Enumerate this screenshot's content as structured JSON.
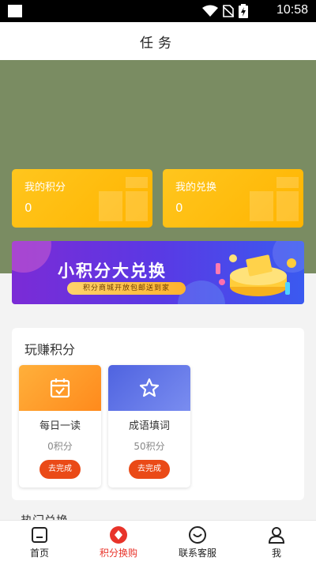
{
  "status": {
    "time": "10:58"
  },
  "header": {
    "title": "任务"
  },
  "cards": {
    "points": {
      "label": "我的积分",
      "value": "0"
    },
    "exchange": {
      "label": "我的兑换",
      "value": "0"
    }
  },
  "banner": {
    "title": "小积分大兑换",
    "subtitle": "积分商城开放包邮送到家"
  },
  "earn": {
    "title": "玩赚积分",
    "tasks": [
      {
        "name": "每日一读",
        "points": "0积分",
        "button": "去完成",
        "icon": "calendar-check-icon",
        "color": "#ff9a2b"
      },
      {
        "name": "成语填词",
        "points": "50积分",
        "button": "去完成",
        "icon": "star-icon",
        "color": "#5c6fe6"
      }
    ]
  },
  "hot": {
    "title": "热门兑换"
  },
  "tabbar": {
    "items": [
      {
        "label": "首页",
        "icon": "home-icon"
      },
      {
        "label": "积分换购",
        "icon": "points-shop-icon"
      },
      {
        "label": "联系客服",
        "icon": "customer-service-icon"
      },
      {
        "label": "我",
        "icon": "user-icon"
      }
    ],
    "active": 1
  },
  "colors": {
    "accent": "#e8332a",
    "hero": "#7a8c62",
    "card": "#ffbf10",
    "button": "#ea4a17"
  }
}
